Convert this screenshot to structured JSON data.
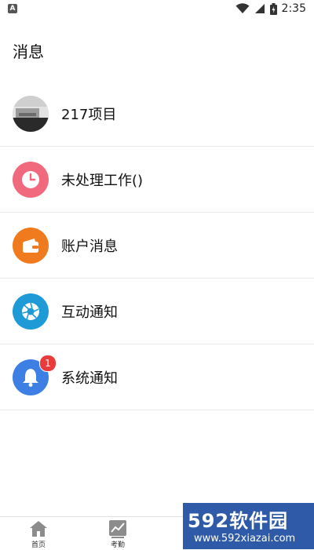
{
  "status_bar": {
    "left_icon": "A",
    "time": "2:35",
    "icons": [
      "wifi-icon",
      "signal-icon",
      "battery-icon"
    ]
  },
  "page": {
    "title": "消息"
  },
  "messages": [
    {
      "label": "217项目",
      "icon": "project-photo-avatar",
      "color": "#5a5a5a"
    },
    {
      "label": "未处理工作()",
      "icon": "clock-icon",
      "color": "#f0697d"
    },
    {
      "label": "账户消息",
      "icon": "wallet-icon",
      "color": "#f07b1e"
    },
    {
      "label": "互动通知",
      "icon": "aperture-icon",
      "color": "#1e9ad6"
    },
    {
      "label": "系统通知",
      "icon": "bell-icon",
      "color": "#3d7fe3",
      "badge": "1"
    }
  ],
  "tabbar": {
    "tabs": [
      {
        "label": "首页",
        "icon": "home-icon"
      },
      {
        "label": "考勤",
        "icon": "attendance-chart-icon"
      }
    ]
  },
  "watermark": {
    "logo": "592软件园",
    "url": "www.592xiazai.com"
  }
}
